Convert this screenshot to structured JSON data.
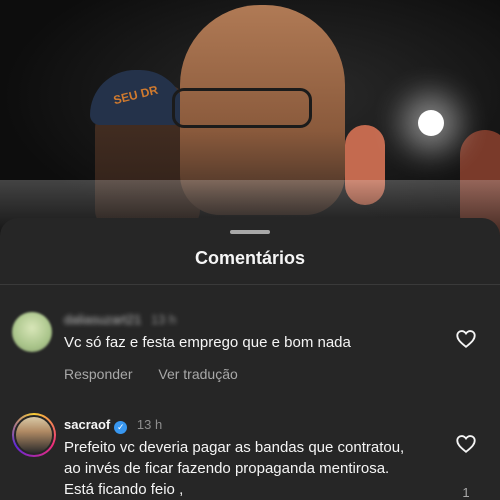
{
  "photo": {
    "cap_text": "SEU DR"
  },
  "sheet": {
    "title": "Comentários"
  },
  "comments": [
    {
      "username": "daliasuzart21",
      "time": "13 h",
      "text": "Vc só faz e festa emprego que e bom nada",
      "reply_label": "Responder",
      "translate_label": "Ver tradução"
    },
    {
      "username": "sacraof",
      "verified": true,
      "time": "13 h",
      "text": "Prefeito vc deveria pagar as bandas que contratou, ao invés de ficar fazendo propaganda mentirosa. Está ficando feio ,",
      "like_count": "1"
    }
  ],
  "colors": {
    "sheet_bg": "#262626",
    "primary_text": "#f5f5f5",
    "secondary_text": "#a8a8a8",
    "verified_blue": "#3897f0"
  }
}
